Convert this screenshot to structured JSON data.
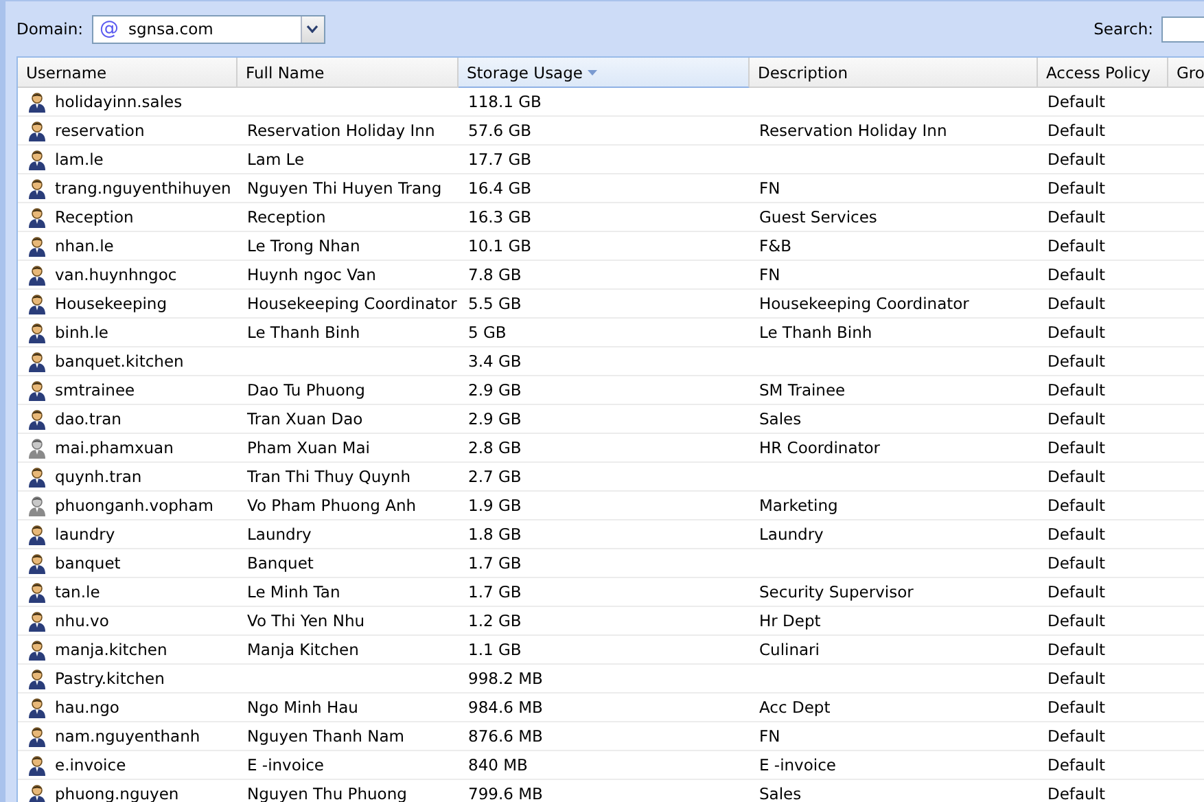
{
  "toolbar": {
    "domain_label": "Domain:",
    "domain_icon": "@",
    "domain_value": "sgnsa.com",
    "search_label": "Search:"
  },
  "table": {
    "columns": [
      {
        "label": "Username",
        "sorted": false
      },
      {
        "label": "Full Name",
        "sorted": false
      },
      {
        "label": "Storage Usage",
        "sorted": true
      },
      {
        "label": "Description",
        "sorted": false
      },
      {
        "label": "Access Policy",
        "sorted": false
      },
      {
        "label": "Gro",
        "sorted": false
      }
    ],
    "rows": [
      {
        "username": "holidayinn.sales",
        "full_name": "",
        "storage": "118.1 GB",
        "description": "",
        "policy": "Default",
        "active": true
      },
      {
        "username": "reservation",
        "full_name": "Reservation Holiday Inn",
        "storage": "57.6 GB",
        "description": "Reservation Holiday Inn",
        "policy": "Default",
        "active": true
      },
      {
        "username": "lam.le",
        "full_name": "Lam Le",
        "storage": "17.7 GB",
        "description": "",
        "policy": "Default",
        "active": true
      },
      {
        "username": "trang.nguyenthihuyen",
        "full_name": "Nguyen Thi Huyen Trang",
        "storage": "16.4 GB",
        "description": "FN",
        "policy": "Default",
        "active": true
      },
      {
        "username": "Reception",
        "full_name": "Reception",
        "storage": "16.3 GB",
        "description": "Guest Services",
        "policy": "Default",
        "active": true
      },
      {
        "username": "nhan.le",
        "full_name": "Le Trong Nhan",
        "storage": "10.1 GB",
        "description": "F&B",
        "policy": "Default",
        "active": true
      },
      {
        "username": "van.huynhngoc",
        "full_name": "Huynh ngoc Van",
        "storage": "7.8 GB",
        "description": "FN",
        "policy": "Default",
        "active": true
      },
      {
        "username": "Housekeeping",
        "full_name": "Housekeeping Coordinator",
        "storage": "5.5 GB",
        "description": "Housekeeping Coordinator",
        "policy": "Default",
        "active": true
      },
      {
        "username": "binh.le",
        "full_name": "Le Thanh Binh",
        "storage": "5 GB",
        "description": "Le Thanh Binh",
        "policy": "Default",
        "active": true
      },
      {
        "username": "banquet.kitchen",
        "full_name": "",
        "storage": "3.4 GB",
        "description": "",
        "policy": "Default",
        "active": true
      },
      {
        "username": "smtrainee",
        "full_name": "Dao Tu Phuong",
        "storage": "2.9 GB",
        "description": "SM Trainee",
        "policy": "Default",
        "active": true
      },
      {
        "username": "dao.tran",
        "full_name": "Tran Xuan Dao",
        "storage": "2.9 GB",
        "description": "Sales",
        "policy": "Default",
        "active": true
      },
      {
        "username": "mai.phamxuan",
        "full_name": "Pham Xuan Mai",
        "storage": "2.8 GB",
        "description": "HR Coordinator",
        "policy": "Default",
        "active": false
      },
      {
        "username": "quynh.tran",
        "full_name": "Tran Thi Thuy Quynh",
        "storage": "2.7 GB",
        "description": "",
        "policy": "Default",
        "active": true
      },
      {
        "username": "phuonganh.vopham",
        "full_name": "Vo Pham Phuong Anh",
        "storage": "1.9 GB",
        "description": "Marketing",
        "policy": "Default",
        "active": false
      },
      {
        "username": "laundry",
        "full_name": "Laundry",
        "storage": "1.8 GB",
        "description": "Laundry",
        "policy": "Default",
        "active": true
      },
      {
        "username": "banquet",
        "full_name": "Banquet",
        "storage": "1.7 GB",
        "description": "",
        "policy": "Default",
        "active": true
      },
      {
        "username": "tan.le",
        "full_name": "Le Minh Tan",
        "storage": "1.7 GB",
        "description": "Security Supervisor",
        "policy": "Default",
        "active": true
      },
      {
        "username": "nhu.vo",
        "full_name": "Vo Thi Yen Nhu",
        "storage": "1.2 GB",
        "description": "Hr Dept",
        "policy": "Default",
        "active": true
      },
      {
        "username": "manja.kitchen",
        "full_name": "Manja Kitchen",
        "storage": "1.1 GB",
        "description": "Culinari",
        "policy": "Default",
        "active": true
      },
      {
        "username": "Pastry.kitchen",
        "full_name": "",
        "storage": "998.2 MB",
        "description": "",
        "policy": "Default",
        "active": true
      },
      {
        "username": "hau.ngo",
        "full_name": "Ngo Minh Hau",
        "storage": "984.6 MB",
        "description": "Acc Dept",
        "policy": "Default",
        "active": true
      },
      {
        "username": "nam.nguyenthanh",
        "full_name": "Nguyen Thanh Nam",
        "storage": "876.6 MB",
        "description": "FN",
        "policy": "Default",
        "active": true
      },
      {
        "username": "e.invoice",
        "full_name": "E -invoice",
        "storage": "840 MB",
        "description": "E -invoice",
        "policy": "Default",
        "active": true
      },
      {
        "username": "phuong.nguyen",
        "full_name": "Nguyen Thu Phuong",
        "storage": "799.6 MB",
        "description": "Sales",
        "policy": "Default",
        "active": true
      }
    ]
  }
}
